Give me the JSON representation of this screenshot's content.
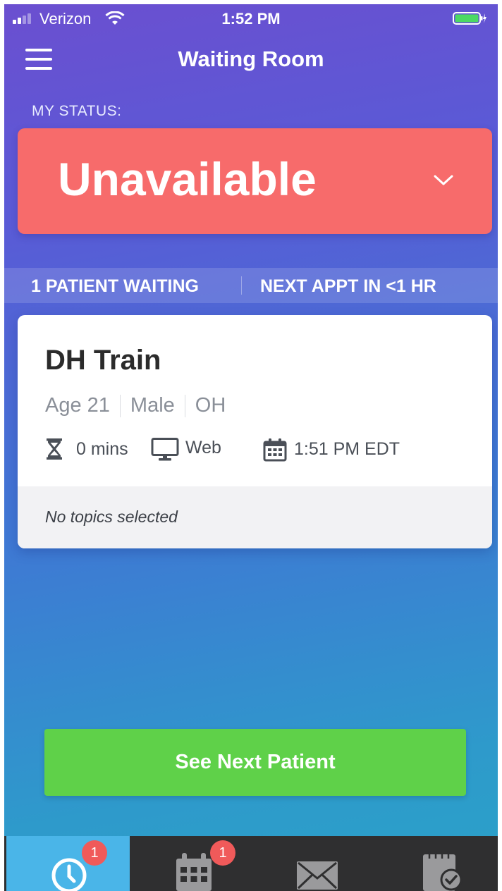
{
  "status_bar": {
    "carrier": "Verizon",
    "time": "1:52 PM",
    "battery_color": "#4cd964"
  },
  "header": {
    "title": "Waiting Room",
    "menu_icon": "hamburger-menu-icon"
  },
  "status": {
    "label": "MY STATUS:",
    "value": "Unavailable",
    "color": "#f76b6b",
    "icon": "chevron-down-icon"
  },
  "queue_info": {
    "patients_waiting": "1 PATIENT WAITING",
    "next_appointment": "NEXT APPT IN <1 HR"
  },
  "patient_card": {
    "name": "DH Train",
    "age": "Age 21",
    "sex": "Male",
    "state": "OH",
    "wait_time": "0 mins",
    "visit_type": "Web",
    "check_in_time": "1:51 PM EDT",
    "topics": "No topics selected",
    "icons": [
      "hourglass-icon",
      "monitor-icon",
      "calendar-icon"
    ]
  },
  "actions": {
    "see_next_patient": "See Next Patient",
    "button_color": "#5fd149"
  },
  "tab_bar": {
    "active_color": "#4ab5e8",
    "tabs": [
      {
        "icon": "clock-icon",
        "badge": "1",
        "active": true
      },
      {
        "icon": "calendar-icon",
        "badge": "1",
        "active": false
      },
      {
        "icon": "envelope-icon",
        "badge": "",
        "active": false
      },
      {
        "icon": "notepad-check-icon",
        "badge": "",
        "active": false
      }
    ]
  }
}
